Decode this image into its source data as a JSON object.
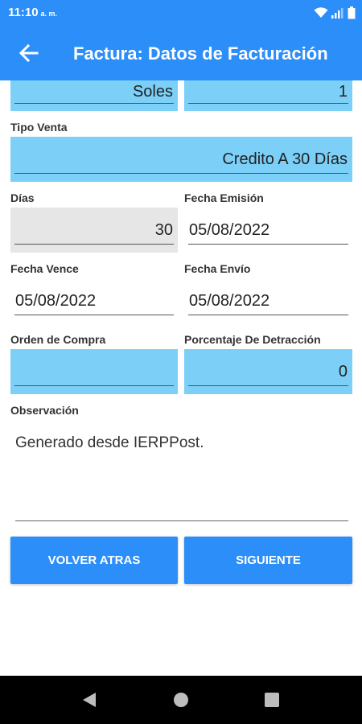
{
  "status_bar": {
    "time": "11:10",
    "ampm": "a. m."
  },
  "app_bar": {
    "title": "Factura: Datos de Facturación",
    "back_icon": "arrow-left-icon"
  },
  "form": {
    "moneda": {
      "value": "Soles"
    },
    "tipo_cambio": {
      "value": "1"
    },
    "tipo_venta": {
      "label": "Tipo Venta",
      "value": "Credito A 30 Días"
    },
    "dias": {
      "label": "Días",
      "value": "30"
    },
    "fecha_emision": {
      "label": "Fecha Emisión",
      "value": "05/08/2022"
    },
    "fecha_vence": {
      "label": "Fecha Vence",
      "value": "05/08/2022"
    },
    "fecha_envio": {
      "label": "Fecha Envío",
      "value": "05/08/2022"
    },
    "orden_compra": {
      "label": "Orden de Compra",
      "value": ""
    },
    "porcentaje_detraccion": {
      "label": "Porcentaje De Detracción",
      "value": "0"
    },
    "observacion": {
      "label": "Observación",
      "value": "Generado desde IERPPost."
    }
  },
  "buttons": {
    "back_label": "VOLVER ATRAS",
    "next_label": "SIGUIENTE"
  },
  "colors": {
    "primary": "#2c8ef8",
    "field_blue": "#7ccff7",
    "field_gray": "#e6e6e6"
  }
}
